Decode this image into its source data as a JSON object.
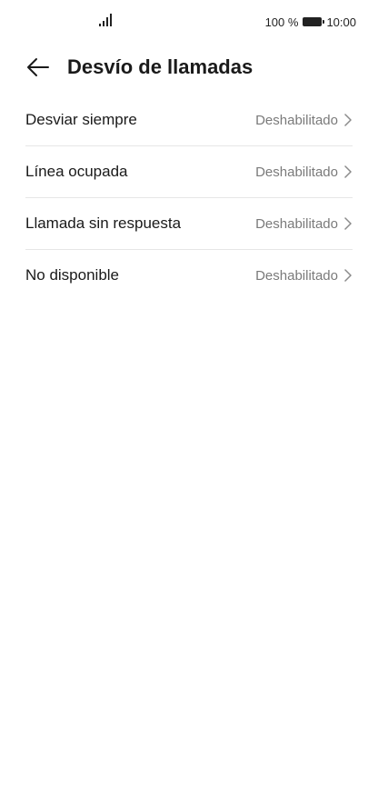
{
  "status_bar": {
    "battery_percent": "100 %",
    "time": "10:00",
    "icons": [
      "signal-icon",
      "battery-icon"
    ]
  },
  "header": {
    "title": "Desvío de llamadas",
    "back_icon": "back-arrow-icon"
  },
  "items": [
    {
      "label": "Desviar siempre",
      "value": "Deshabilitado"
    },
    {
      "label": "Línea ocupada",
      "value": "Deshabilitado"
    },
    {
      "label": "Llamada sin respuesta",
      "value": "Deshabilitado"
    },
    {
      "label": "No disponible",
      "value": "Deshabilitado"
    }
  ],
  "colors": {
    "text_primary": "#1a1a1a",
    "text_secondary": "#7a7a7a",
    "divider": "#e6e6e6",
    "background": "#ffffff"
  }
}
